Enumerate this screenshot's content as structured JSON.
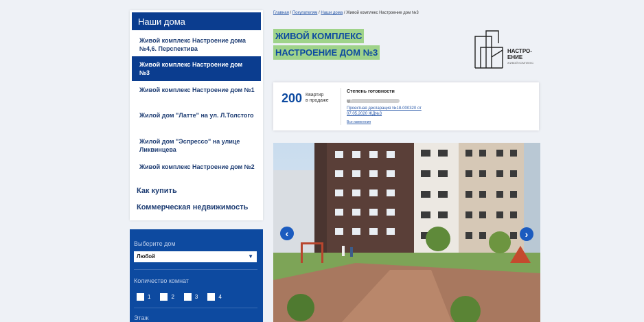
{
  "sidebar": {
    "header": "Наши дома",
    "items": [
      {
        "label": "Живой комплекс Настроение дома №4,6. Перспектива"
      },
      {
        "label": "Живой комплекс Настроение дом №3"
      },
      {
        "label": "Живой комплекс Настроение дом №1"
      },
      {
        "label": "Жилой дом \"Латте\" на ул. Л.Толстого"
      },
      {
        "label": "Жилой дом \"Эспрессо\" на улице Ликвинцева"
      },
      {
        "label": "Живой комплекс Настроение дом №2"
      }
    ],
    "links": [
      "Как купить",
      "Коммерческая недвижимость"
    ]
  },
  "filter": {
    "house_label": "Выберите дом",
    "house_value": "Любой",
    "rooms_label": "Количество комнат",
    "rooms": [
      "1",
      "2",
      "3",
      "4"
    ],
    "floor_label": "Этаж"
  },
  "breadcrumb": {
    "items": [
      "Главная",
      "Покупателям",
      "Наши дома"
    ],
    "separator": " / ",
    "current": "Живой комплекс Настроение дом №3"
  },
  "title": {
    "line1": "ЖИВОЙ КОМПЛЕКС",
    "line2": "НАСТРОЕНИЕ ДОМ №3"
  },
  "logo": {
    "line1": "НАСТРО-",
    "line2": "ЕНИЕ",
    "line3": "ЖИВОЙ КОМПЛЕКС"
  },
  "info": {
    "count": "200",
    "count_label_1": "Квартир",
    "count_label_2": "в продаже",
    "readiness_title": "Степень готовности",
    "readiness_percent": "4%",
    "readiness_value": 0.04,
    "declaration_1": "Проектная декларация №18-000320 от",
    "declaration_2": "07.05.2020 ЖД№3",
    "changes": "Все изменения"
  },
  "gallery": {
    "prev": "‹",
    "next": "›"
  },
  "colors": {
    "brand_blue": "#0b3d8f",
    "filter_blue": "#0d4aa0",
    "title_bg": "#9fd38a",
    "page_bg": "#eef1f6",
    "arrow": "#1b5bbf"
  }
}
